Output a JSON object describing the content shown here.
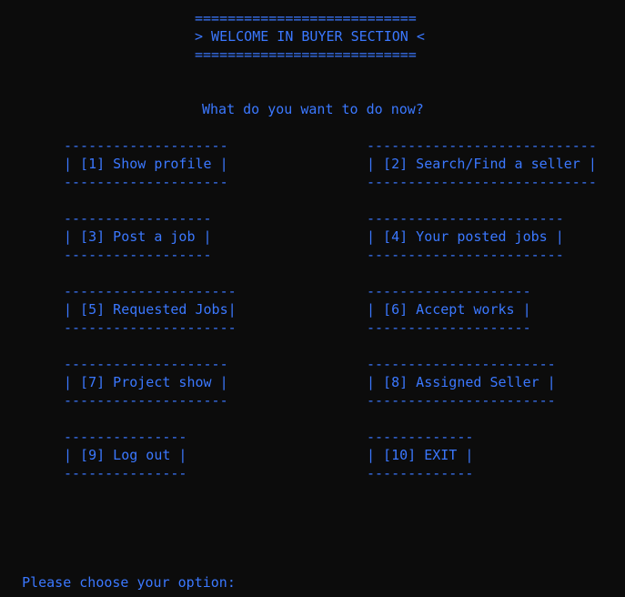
{
  "header": {
    "rule_top": "===========================",
    "title": "> WELCOME IN BUYER SECTION <",
    "rule_bottom": "==========================="
  },
  "question": "What do you want to do now?",
  "options": [
    {
      "rule": "--------------------",
      "label": "| [1] Show profile |"
    },
    {
      "rule": "----------------------------",
      "label": "| [2] Search/Find a seller |"
    },
    {
      "rule": "------------------",
      "label": "| [3] Post a job |"
    },
    {
      "rule": "------------------------",
      "label": "| [4] Your posted jobs |"
    },
    {
      "rule": "---------------------",
      "label": "| [5] Requested Jobs|"
    },
    {
      "rule": "--------------------",
      "label": "| [6] Accept works |"
    },
    {
      "rule": "--------------------",
      "label": "| [7] Project show |"
    },
    {
      "rule": "-----------------------",
      "label": "| [8] Assigned Seller |"
    },
    {
      "rule": "---------------",
      "label": "| [9] Log out |"
    },
    {
      "rule": "-------------",
      "label": "| [10] EXIT |"
    }
  ],
  "prompt": "Please choose your option:",
  "colors": {
    "background": "#0c0c0c",
    "text": "#3b78ff"
  }
}
